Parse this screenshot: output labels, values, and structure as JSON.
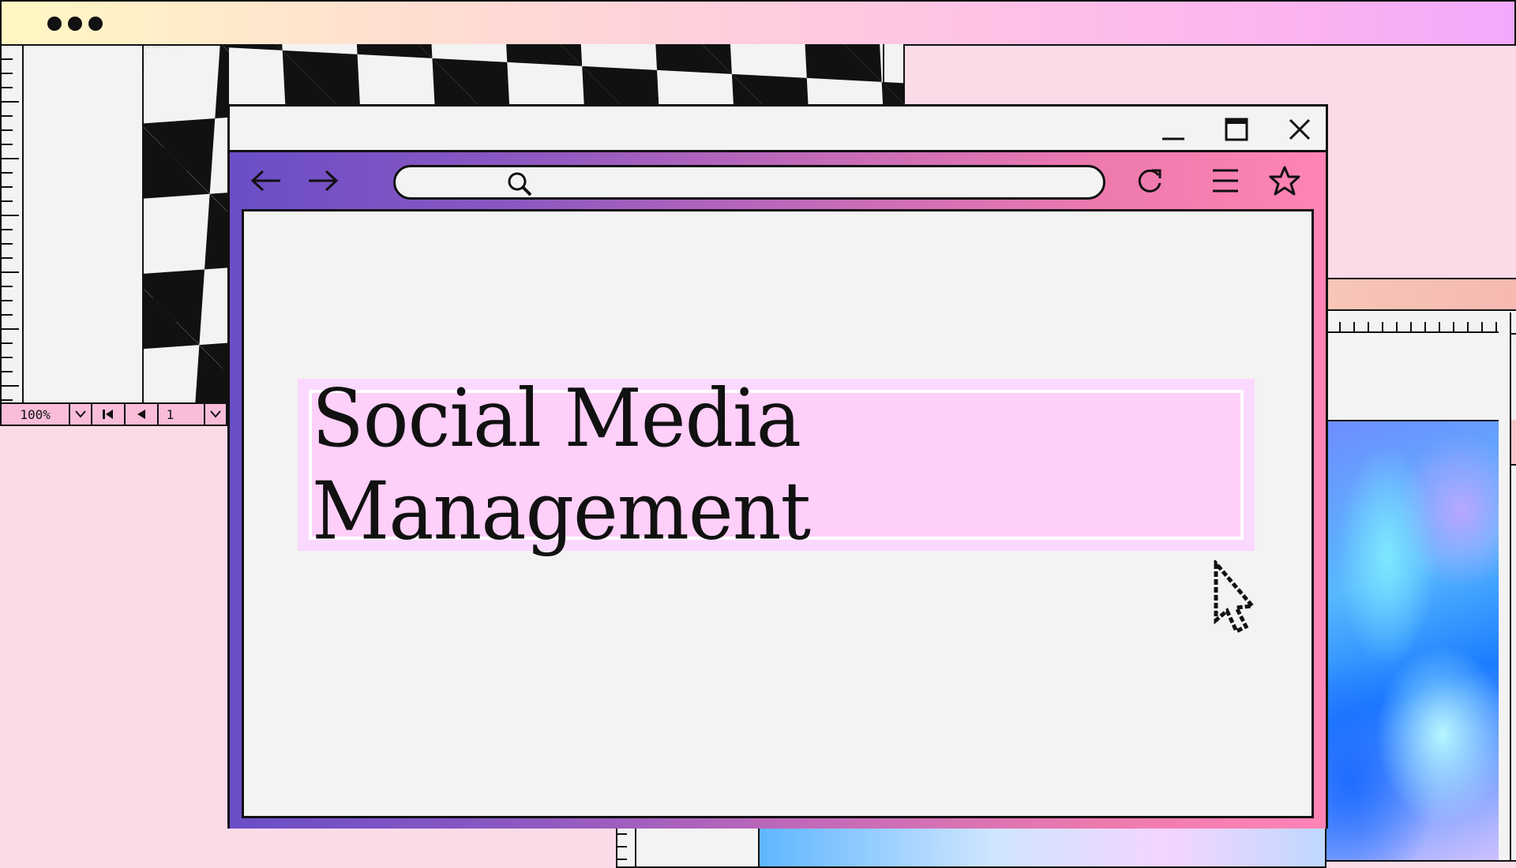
{
  "top_window": {
    "dots": [
      "dot-1",
      "dot-2",
      "dot-3"
    ]
  },
  "left_window": {
    "zoom_value": "100%",
    "page_value": "1",
    "zoom_dropdown_icon": "chevron-down-icon",
    "page_dropdown_icon": "chevron-down-icon",
    "first_page_icon": "skip-to-first-icon",
    "prev_page_icon": "triangle-left-icon"
  },
  "right_window": {
    "scroll_up_label": "^"
  },
  "browser": {
    "window_controls": [
      "minimize-icon",
      "maximize-icon",
      "close-icon"
    ],
    "nav_icons": [
      "back-arrow-icon",
      "forward-arrow-icon",
      "reload-icon",
      "menu-icon",
      "star-icon"
    ],
    "url_value": "",
    "banner_title": "Social Media Management"
  },
  "colors": {
    "gradient_start": "#6a4ec7",
    "gradient_end": "#ff84b6",
    "banner_fill": "#fecff9",
    "page_bg": "#fcdbe8"
  }
}
